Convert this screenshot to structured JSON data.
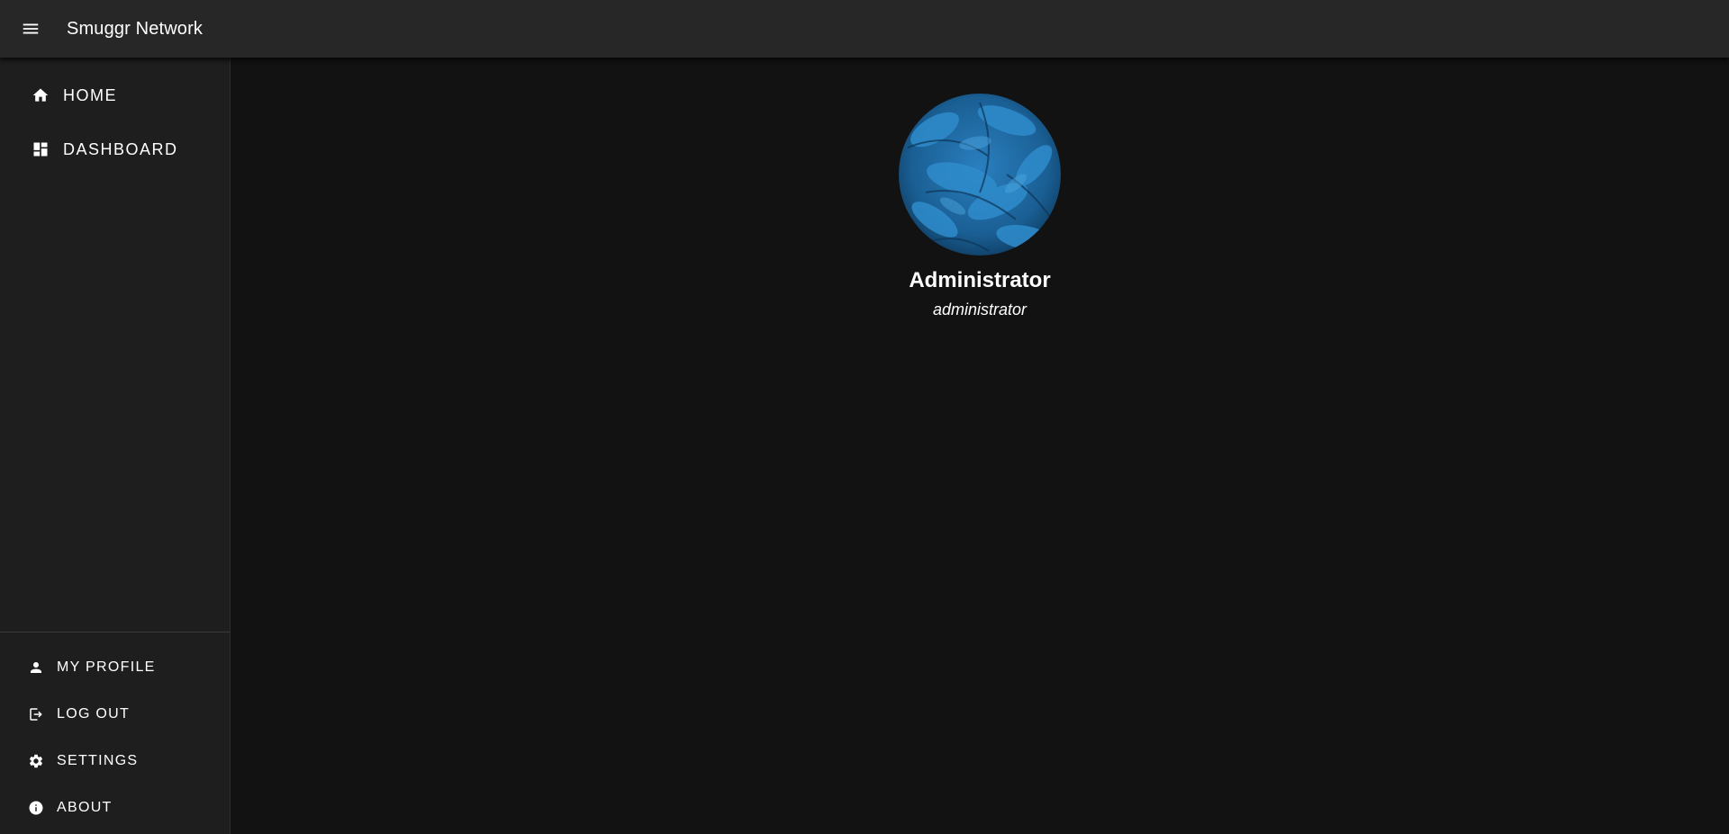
{
  "app": {
    "title": "Smuggr Network",
    "menu_icon": "hamburger-menu-icon"
  },
  "sidebar": {
    "top_items": [
      {
        "label": "HOME",
        "icon": "home-icon"
      },
      {
        "label": "DASHBOARD",
        "icon": "dashboard-icon"
      }
    ],
    "bottom_items": [
      {
        "label": "MY PROFILE",
        "icon": "person-icon"
      },
      {
        "label": "LOG OUT",
        "icon": "logout-icon"
      },
      {
        "label": "SETTINGS",
        "icon": "gear-icon"
      },
      {
        "label": "ABOUT",
        "icon": "info-icon"
      }
    ]
  },
  "profile": {
    "display_name": "Administrator",
    "role": "administrator",
    "avatar_description": "blue-leaves-avatar"
  },
  "colors": {
    "app_bar": "#272727",
    "sidebar": "#1e1e1e",
    "background": "#121212",
    "text": "#ffffff",
    "avatar_accent": "#1f6ea8"
  }
}
